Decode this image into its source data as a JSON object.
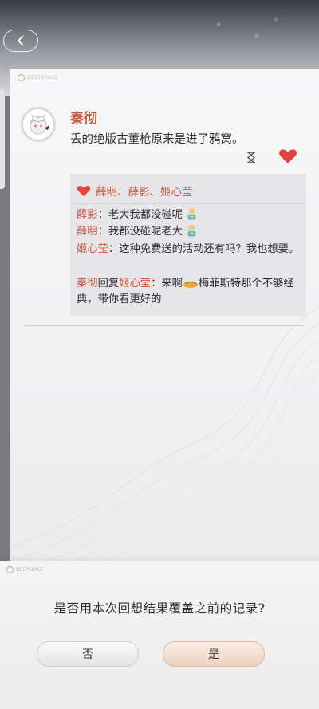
{
  "brand": {
    "text": "DEEPSPACE"
  },
  "post": {
    "author": "秦彻",
    "text": "丢的绝版古董枪原来是进了鸦窝。"
  },
  "likes": {
    "text": "薛明、薛影、姬心莹"
  },
  "comments": [
    {
      "name": "薛影",
      "sep": "：",
      "text": "老大我都没碰呢"
    },
    {
      "name": "薛明",
      "sep": "：",
      "text": "我都没碰呢老大"
    },
    {
      "name": "姬心莹",
      "sep": "：",
      "text": "这种免费送的活动还有吗？我也想要。"
    },
    {
      "name": "秦彻",
      "reply_word": "回复",
      "reply_to": "姬心莹",
      "sep": "：",
      "text_before": "来啊",
      "text_after": "梅菲斯特那个不够经典，带你看更好的"
    }
  ],
  "dialog": {
    "question": "是否用本次回想结果覆盖之前的记录?",
    "no_label": "否",
    "yes_label": "是"
  },
  "icons": {
    "back": "back-chevron-icon",
    "timer": "hourglass-icon",
    "like": "heart-icon",
    "emoji": "person-emoji-icon",
    "gift": "gift-emoji-icon"
  },
  "colors": {
    "accent": "#c6573f",
    "heart": "#e4463f",
    "text": "#2e2e30"
  }
}
